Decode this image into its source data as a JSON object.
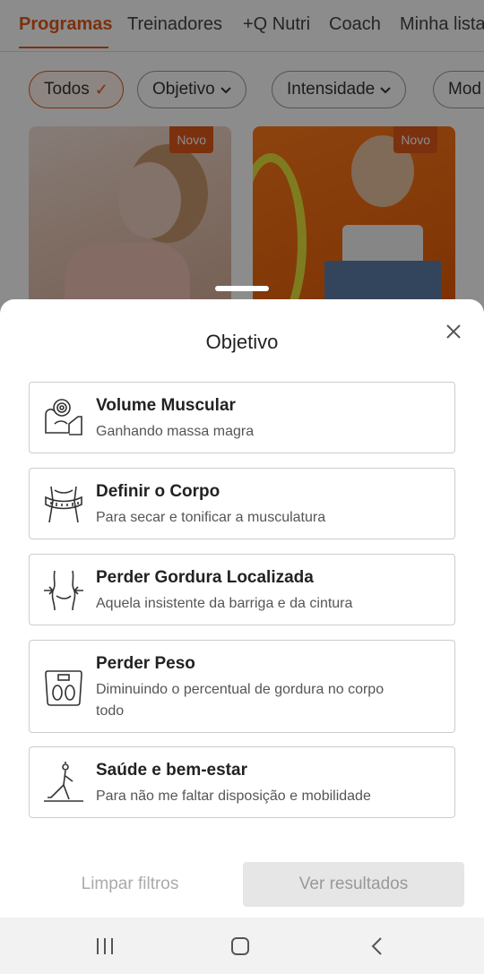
{
  "tabs": [
    {
      "label": "Programas",
      "active": true
    },
    {
      "label": "Treinadores",
      "active": false
    },
    {
      "label": "+Q Nutri",
      "active": false
    },
    {
      "label": "Coach",
      "active": false
    },
    {
      "label": "Minha lista",
      "active": false
    }
  ],
  "filters": [
    {
      "label": "Todos",
      "active": true,
      "icon": "check-icon"
    },
    {
      "label": "Objetivo",
      "active": false,
      "icon": "chevron-down-icon"
    },
    {
      "label": "Intensidade",
      "active": false,
      "icon": "chevron-down-icon"
    },
    {
      "label": "Mod",
      "active": false,
      "icon": ""
    }
  ],
  "cards": [
    {
      "badge": "Novo"
    },
    {
      "badge": "Novo"
    }
  ],
  "sheet": {
    "title": "Objetivo",
    "options": [
      {
        "title": "Volume Muscular",
        "description": "Ganhando massa magra",
        "icon": "bicep-weight-icon"
      },
      {
        "title": "Definir o Corpo",
        "description": "Para secar e tonificar a musculatura",
        "icon": "measuring-tape-torso-icon"
      },
      {
        "title": "Perder Gordura Localizada",
        "description": "Aquela insistente da barriga e da cintura",
        "icon": "waist-arrows-icon"
      },
      {
        "title": "Perder Peso",
        "description": "Diminuindo o percentual de gordura no corpo todo",
        "icon": "scale-icon"
      },
      {
        "title": "Saúde e bem-estar",
        "description": "Para não me faltar disposição e mobilidade",
        "icon": "yoga-pose-icon"
      }
    ],
    "clear_label": "Limpar filtros",
    "results_label": "Ver resultados"
  },
  "colors": {
    "accent": "#e05a1a",
    "disabled_button_bg": "#e6e6e6",
    "disabled_text": "#999999"
  }
}
